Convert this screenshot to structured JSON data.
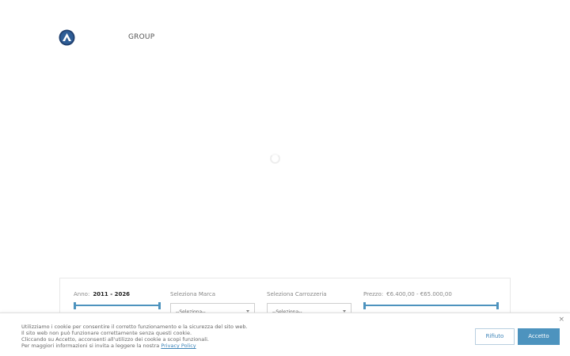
{
  "header": {
    "logo_icon": "mountain-logo-icon",
    "brand_text": "GROUP"
  },
  "loader": {
    "icon": "spinner-icon"
  },
  "search": {
    "year": {
      "label": "Anno:",
      "value": "2011 - 2026"
    },
    "brand": {
      "label": "Seleziona Marca",
      "selected": "--Seleziona--"
    },
    "body": {
      "label": "Seleziona Carrozzeria",
      "selected": "--Seleziona--"
    },
    "price": {
      "label": "Prezzo:",
      "value": "€6.400,00 - €65.000,00"
    }
  },
  "cookie": {
    "lines": [
      "Utilizziamo i cookie per consentire il corretto funzionamento e la sicurezza del sito web.",
      "Il sito web non può funzionare correttamente senza questi cookie.",
      "Cliccando su Accetto, acconsenti all'utilizzo dei cookie a scopi funzionali."
    ],
    "last_line_prefix": "Per maggiori informazioni si invita a leggere la nostra",
    "privacy_link": "Privacy Policy",
    "close_label": "×",
    "reject_label": "Rifiuto",
    "accept_label": "Accetto"
  },
  "colors": {
    "accent": "#4d93be",
    "link": "#3d84b8"
  }
}
